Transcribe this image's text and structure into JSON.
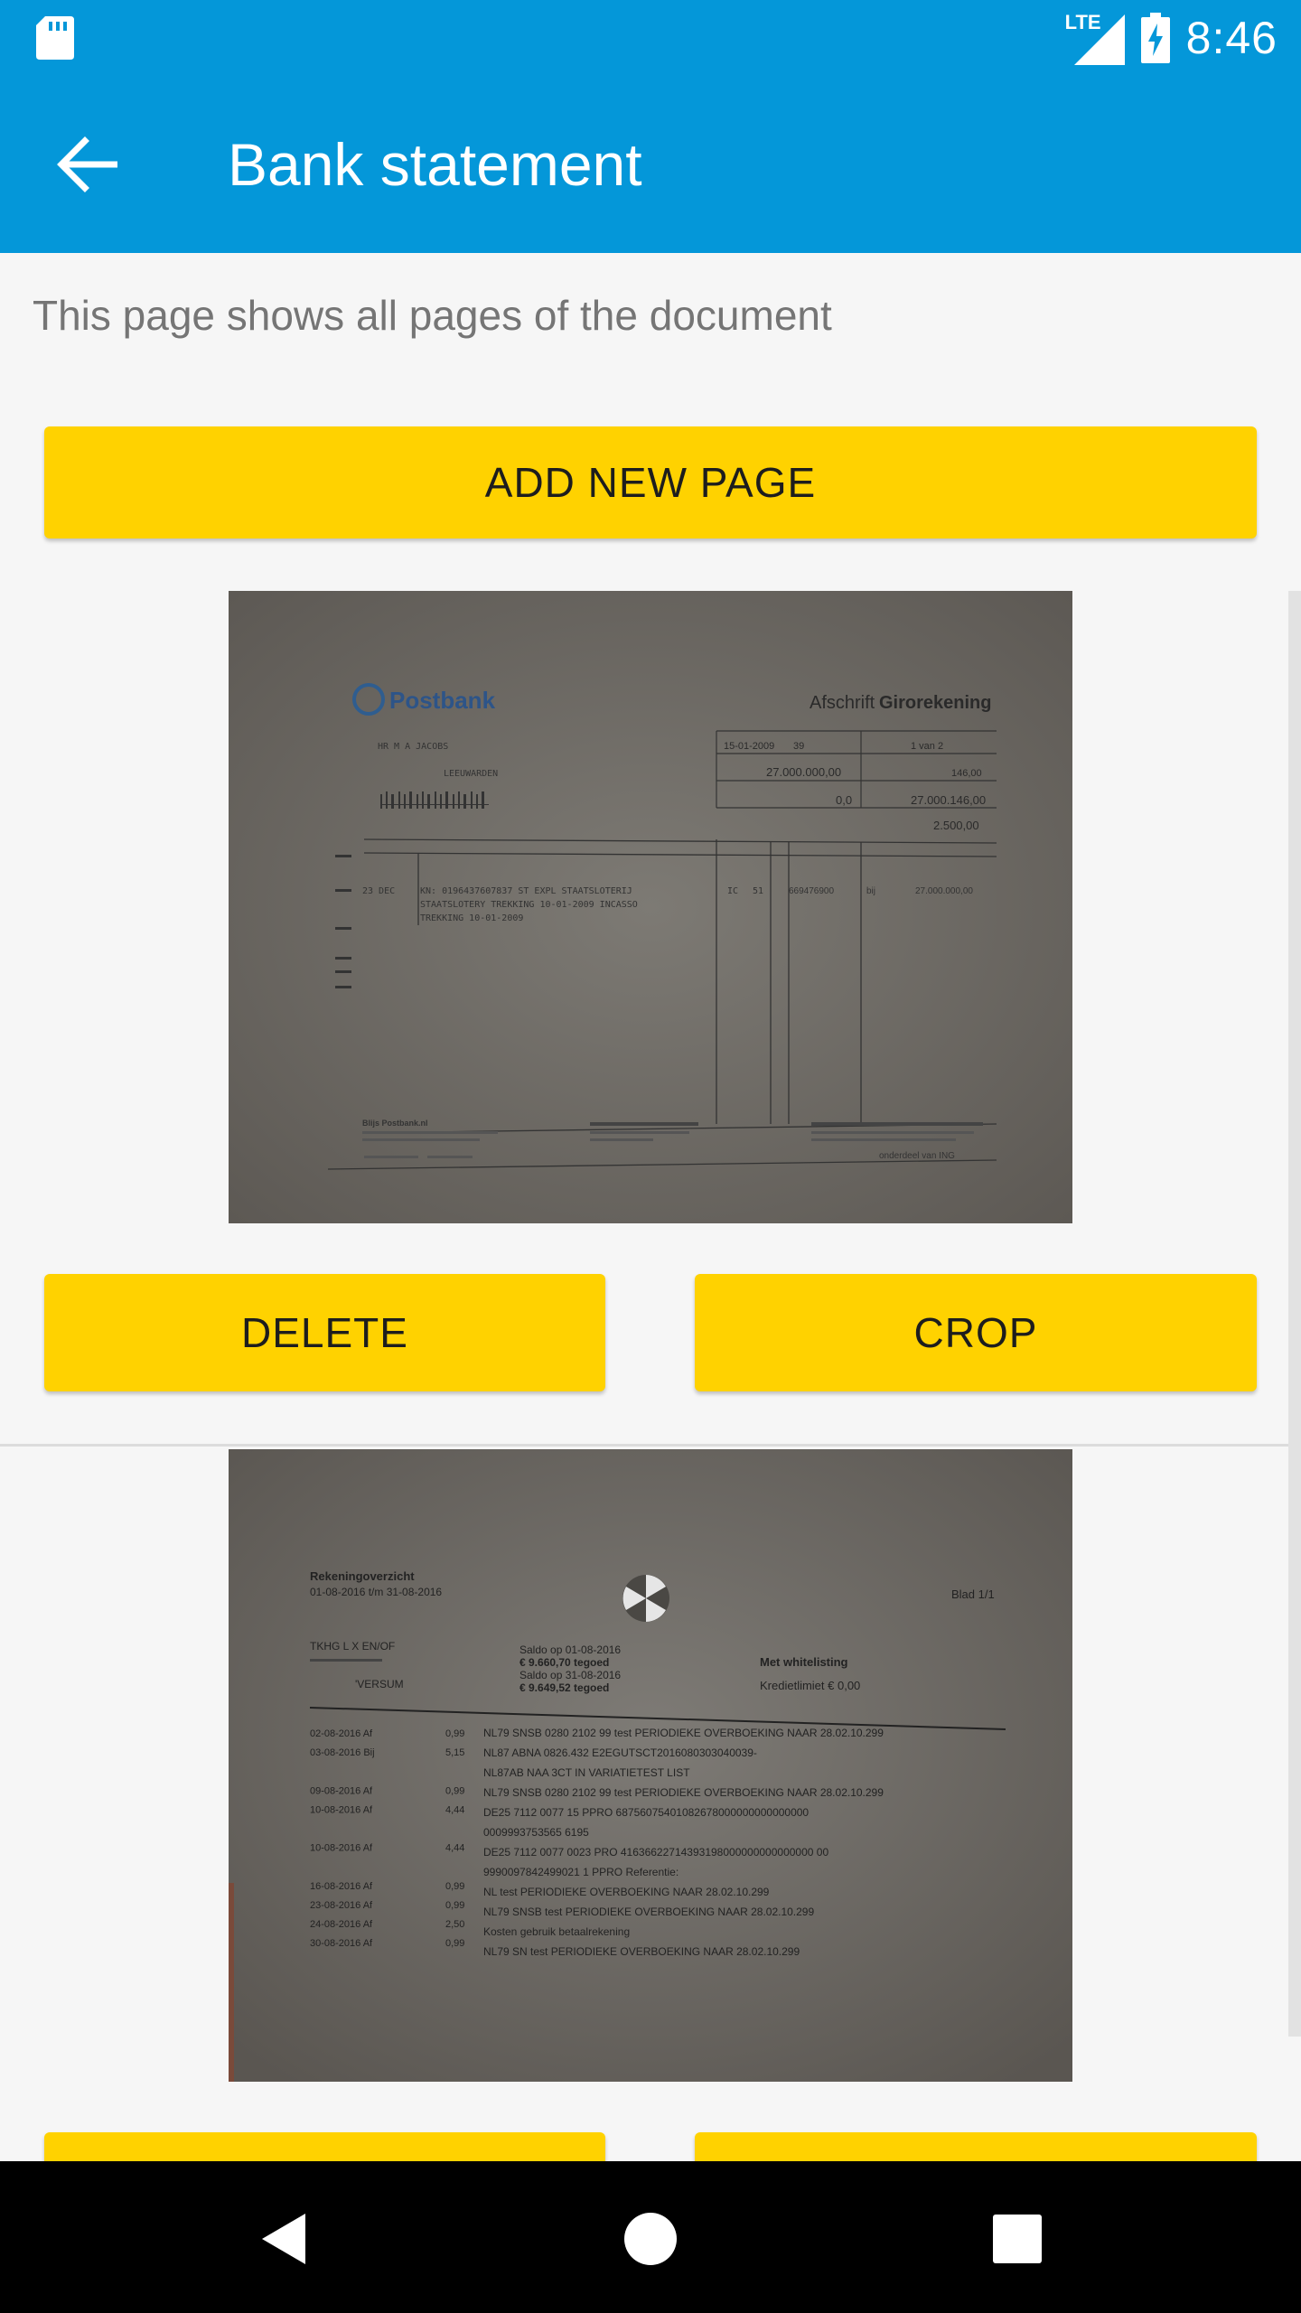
{
  "status_bar": {
    "network": "LTE",
    "time": "8:46",
    "icons": [
      "sd-card-icon",
      "signal-icon",
      "battery-charging-icon"
    ]
  },
  "app_bar": {
    "back_icon": "arrow-back-icon",
    "title": "Bank statement",
    "color": "#0497d9"
  },
  "content": {
    "description": "This page shows all pages of the document",
    "add_button": "ADD NEW PAGE",
    "accent_color": "#ffd200",
    "pages": [
      {
        "delete_label": "DELETE",
        "crop_label": "CROP",
        "image": {
          "brand": "Postbank",
          "heading_prefix": "Afschrift",
          "heading_bold": "Girorekening",
          "name": "HR M A JACOBS",
          "city": "LEEUWARDEN",
          "date": "15-01-2009",
          "number": "39",
          "page": "1 van 2",
          "total1": "27.000.000,00",
          "old_balance": "146,00",
          "total2": "0,0",
          "new_balance": "27.000.146,00",
          "credit_limit": "2.500,00",
          "row_date": "23 DEC",
          "row_line1": "KN: 0196437607837 ST EXPL STAATSLOTERIJ",
          "row_line2": "STAATSLOTERY TREKKING 10-01-2009 INCASSO",
          "row_line3": "TREKKING 10-01-2009",
          "row_code": "IC",
          "row_num": "51",
          "row_account": "669476900",
          "row_type": "bij",
          "row_amount": "27.000.000,00",
          "footer_left": "Blijs Postbank.nl",
          "footer_right": "onderdeel van ING"
        }
      },
      {
        "delete_label": "",
        "crop_label": "",
        "image": {
          "title": "Rekeningoverzicht",
          "period": "01-08-2016 t/m 31-08-2016",
          "page": "Blad 1/1",
          "holder1": "TKHG L X EN/OF",
          "holder2": "'VERSUM",
          "saldo1": "Saldo op 01-08-2016",
          "saldo1_val": "€ 9.660,70 tegoed",
          "saldo2": "Saldo op 31-08-2016",
          "saldo2_val": "€ 9.649,52 tegoed",
          "whitelist": "Met whitelisting",
          "credit": "Kredietlimiet € 0,00",
          "rows": [
            {
              "d": "02-08-2016 Af",
              "a": "0,99",
              "t": "NL79 SNSB 0280 2102 99 test PERIODIEKE OVERBOEKING NAAR 28.02.10.299"
            },
            {
              "d": "03-08-2016 Bij",
              "a": "5,15",
              "t": "NL87 ABNA 0826.432   E2EGUTSCT2016080303040039-"
            },
            {
              "d": "",
              "a": "",
              "t": "NL87AB NAA   3CT IN VARIATIETEST LIST"
            },
            {
              "d": "09-08-2016 Af",
              "a": "0,99",
              "t": "NL79 SNSB 0280 2102 99 test PERIODIEKE OVERBOEKING NAAR 28.02.10.299"
            },
            {
              "d": "10-08-2016 Af",
              "a": "4,44",
              "t": "DE25 7112 0077   15 PPRO 68756075401082678000000000000000"
            },
            {
              "d": "",
              "a": "",
              "t": "0009993753565 6195   "
            },
            {
              "d": "10-08-2016 Af",
              "a": "4,44",
              "t": "DE25 7112 0077 0023   PRO 41636622714393198000000000000000 00"
            },
            {
              "d": "",
              "a": "",
              "t": "9990097842499021   1 PPRO Referentie:"
            },
            {
              "d": "16-08-2016 Af",
              "a": "0,99",
              "t": "NL   test PERIODIEKE OVERBOEKING NAAR 28.02.10.299"
            },
            {
              "d": "23-08-2016 Af",
              "a": "0,99",
              "t": "NL79 SNSB   test PERIODIEKE OVERBOEKING NAAR 28.02.10.299"
            },
            {
              "d": "24-08-2016 Af",
              "a": "2,50",
              "t": "Kosten gebruik betaalrekening"
            },
            {
              "d": "30-08-2016 Af",
              "a": "0,99",
              "t": "NL79 SN   test PERIODIEKE OVERBOEKING NAAR 28.02.10.299"
            }
          ]
        }
      }
    ]
  },
  "nav_bar": {
    "back_icon": "nav-back-icon",
    "home_icon": "nav-home-icon",
    "recents_icon": "nav-recents-icon"
  }
}
